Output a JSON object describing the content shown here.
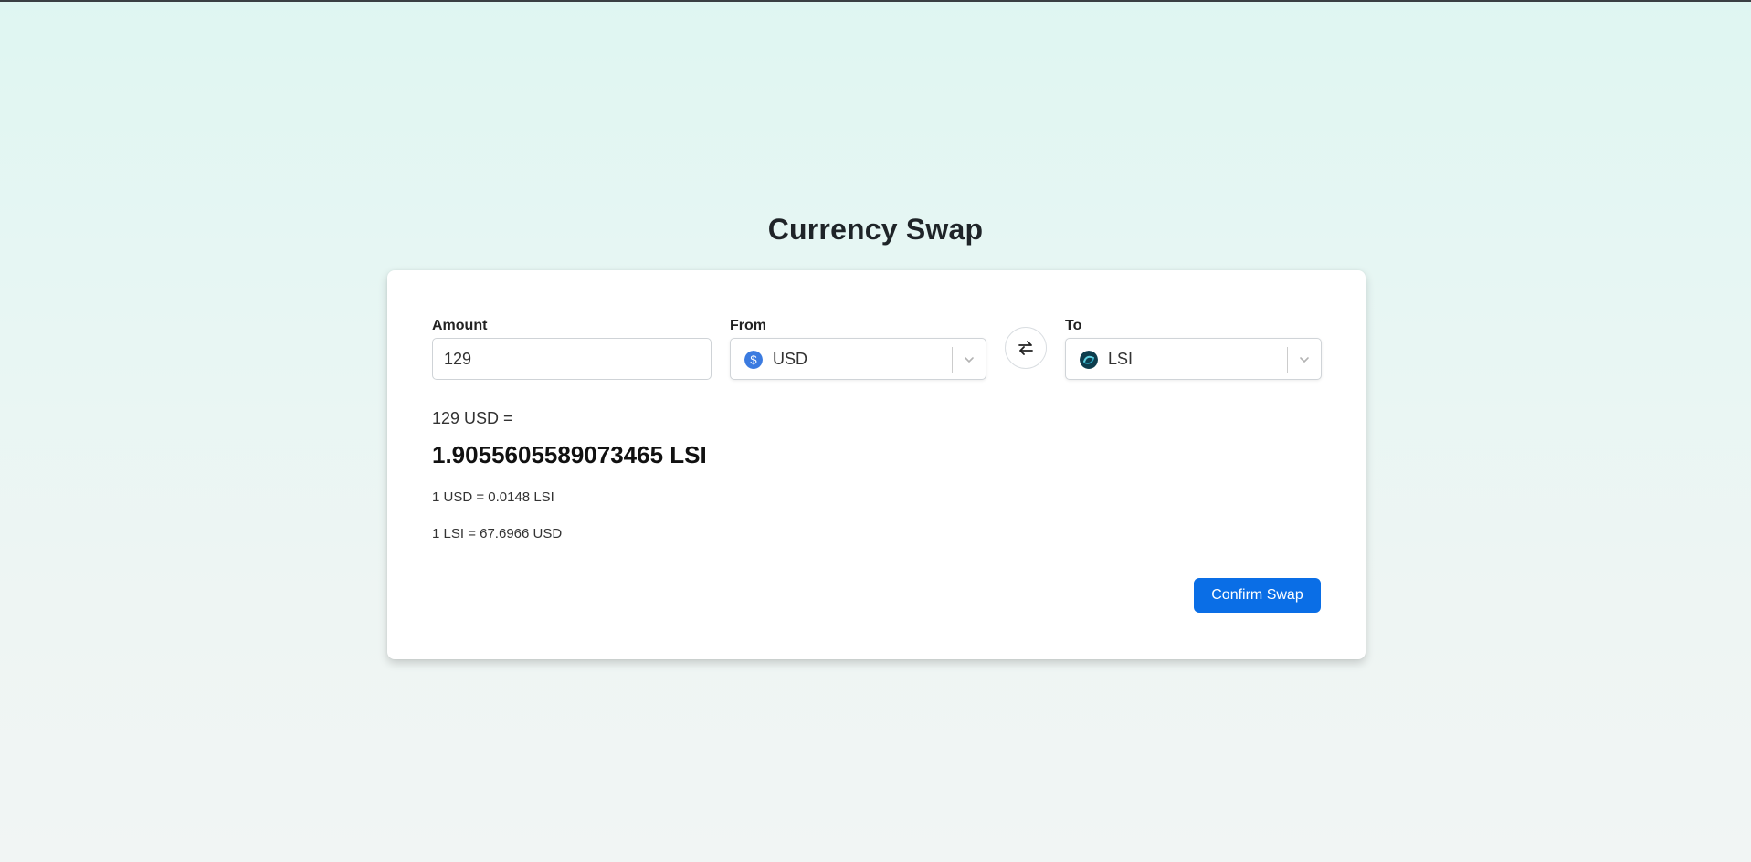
{
  "page": {
    "title": "Currency Swap"
  },
  "form": {
    "amount": {
      "label": "Amount",
      "value": "129"
    },
    "from": {
      "label": "From",
      "value": "USD",
      "icon": "usd-coin-icon"
    },
    "to": {
      "label": "To",
      "value": "LSI",
      "icon": "lsi-coin-icon"
    },
    "swap_icon": "swap-arrows-icon"
  },
  "result": {
    "equation": "129 USD =",
    "converted": "1.9055605589073465 LSI",
    "rate_forward": "1 USD = 0.0148 LSI",
    "rate_reverse": "1 LSI = 67.6966 USD"
  },
  "actions": {
    "confirm_label": "Confirm Swap"
  },
  "colors": {
    "accent": "#0a6ee6",
    "usd_coin": "#3b7be0",
    "lsi_coin": "#0d3d4d"
  }
}
